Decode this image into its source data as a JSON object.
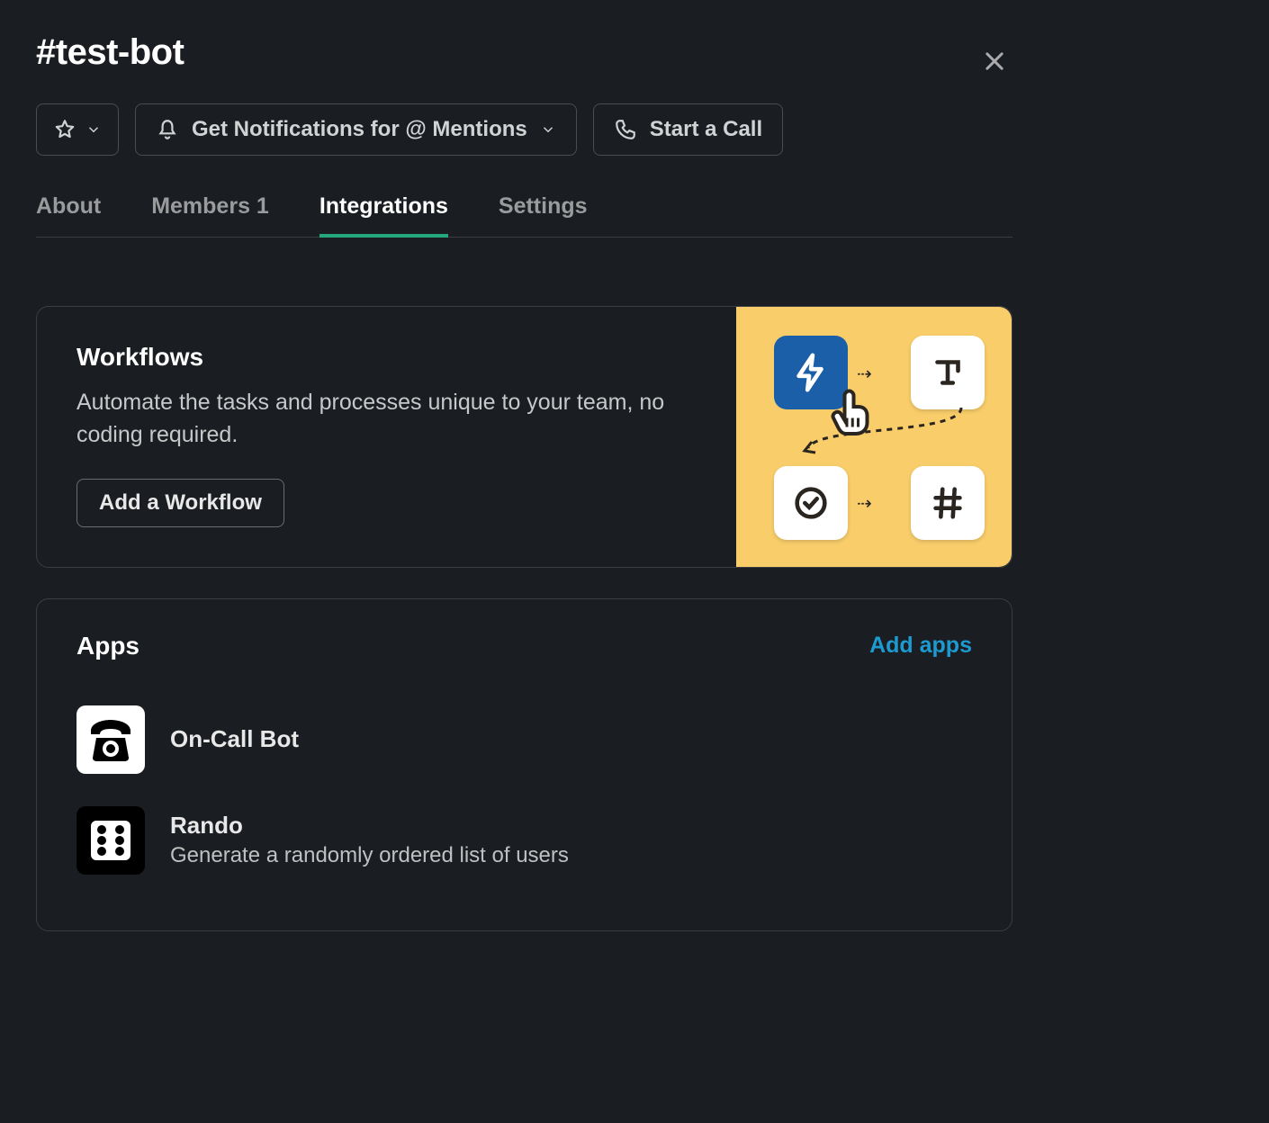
{
  "header": {
    "channel_prefix": "#",
    "channel_name": "test-bot",
    "notifications_label": "Get Notifications for @ Mentions",
    "call_label": "Start a Call"
  },
  "tabs": {
    "about": "About",
    "members": "Members 1",
    "integrations": "Integrations",
    "settings": "Settings"
  },
  "workflows": {
    "title": "Workflows",
    "desc": "Automate the tasks and processes unique to your team, no coding required.",
    "button": "Add a Workflow"
  },
  "apps": {
    "title": "Apps",
    "add_link": "Add apps",
    "items": [
      {
        "name": "On-Call Bot",
        "desc": ""
      },
      {
        "name": "Rando",
        "desc": "Generate a randomly ordered list of users"
      }
    ]
  }
}
